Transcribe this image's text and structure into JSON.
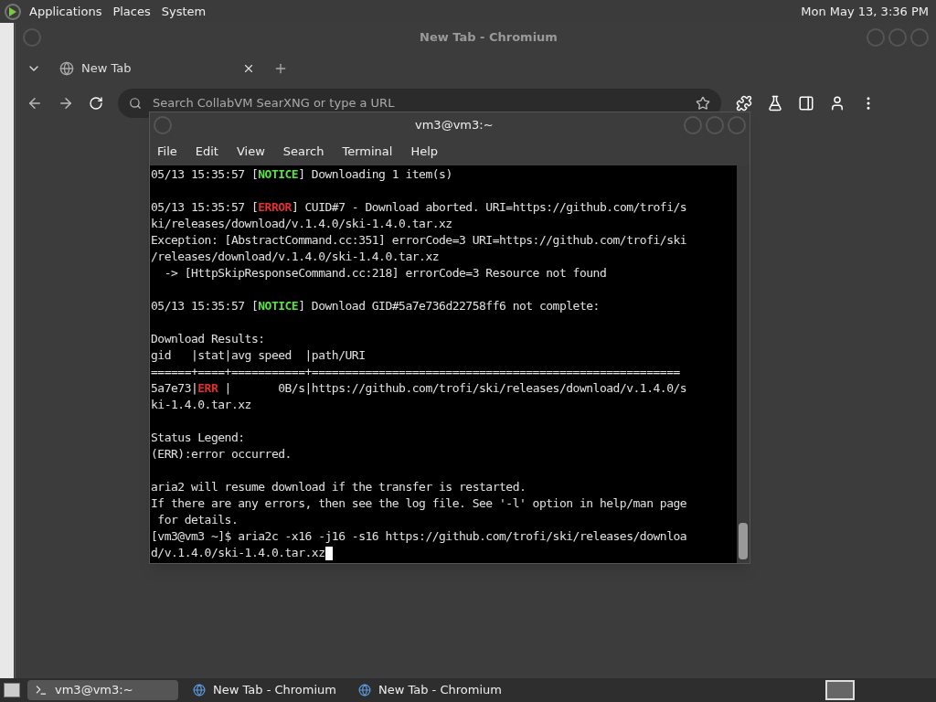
{
  "top_panel": {
    "menus": [
      "Applications",
      "Places",
      "System"
    ],
    "clock": "Mon May 13,  3:36 PM"
  },
  "browser": {
    "title": "New Tab - Chromium",
    "tabs": [
      {
        "label": "New Tab",
        "selected": true
      }
    ],
    "address_placeholder": "Search CollabVM SearXNG or type a URL"
  },
  "terminal": {
    "title": "vm3@vm3:~",
    "menus": [
      "File",
      "Edit",
      "View",
      "Search",
      "Terminal",
      "Help"
    ],
    "blocks": [
      [
        [
          {
            "text": "05/13 15:35:57 [",
            "kind": "plain"
          },
          {
            "text": "NOTICE",
            "kind": "notice"
          },
          {
            "text": "] Downloading 1 item(s)",
            "kind": "plain"
          }
        ]
      ],
      [
        [
          {
            "text": "05/13 15:35:57 [",
            "kind": "plain"
          },
          {
            "text": "ERROR",
            "kind": "error"
          },
          {
            "text": "] CUID#7 - Download aborted. URI=https://github.com/trofi/s",
            "kind": "plain"
          }
        ],
        [
          {
            "text": "ki/releases/download/v.1.4.0/ski-1.4.0.tar.xz",
            "kind": "plain"
          }
        ],
        [
          {
            "text": "Exception: [AbstractCommand.cc:351] errorCode=3 URI=https://github.com/trofi/ski",
            "kind": "plain"
          }
        ],
        [
          {
            "text": "/releases/download/v.1.4.0/ski-1.4.0.tar.xz",
            "kind": "plain"
          }
        ],
        [
          {
            "text": "  -> [HttpSkipResponseCommand.cc:218] errorCode=3 Resource not found",
            "kind": "plain"
          }
        ]
      ],
      [
        [
          {
            "text": "05/13 15:35:57 [",
            "kind": "plain"
          },
          {
            "text": "NOTICE",
            "kind": "notice"
          },
          {
            "text": "] Download GID#5a7e736d22758ff6 not complete:",
            "kind": "plain"
          }
        ]
      ],
      [
        [
          {
            "text": "Download Results:",
            "kind": "plain"
          }
        ],
        [
          {
            "text": "gid   |stat|avg speed  |path/URI",
            "kind": "plain"
          }
        ],
        [
          {
            "text": "======+====+===========+=======================================================",
            "kind": "plain"
          }
        ],
        [
          {
            "text": "5a7e73|",
            "kind": "plain"
          },
          {
            "text": "ERR",
            "kind": "error"
          },
          {
            "text": " |       0B/s|https://github.com/trofi/ski/releases/download/v.1.4.0/s",
            "kind": "plain"
          }
        ],
        [
          {
            "text": "ki-1.4.0.tar.xz",
            "kind": "plain"
          }
        ]
      ],
      [
        [
          {
            "text": "Status Legend:",
            "kind": "plain"
          }
        ],
        [
          {
            "text": "(ERR):error occurred.",
            "kind": "plain"
          }
        ]
      ],
      [
        [
          {
            "text": "aria2 will resume download if the transfer is restarted.",
            "kind": "plain"
          }
        ],
        [
          {
            "text": "If there are any errors, then see the log file. See '-l' option in help/man page",
            "kind": "plain"
          }
        ],
        [
          {
            "text": " for details.",
            "kind": "plain"
          }
        ],
        [
          {
            "text": "[vm3@vm3 ~]$ aria2c -x16 -j16 -s16 https://github.com/trofi/ski/releases/downloa",
            "kind": "plain"
          }
        ],
        [
          {
            "text": "d/v.1.4.0/ski-1.4.0.tar.xz",
            "kind": "plain"
          }
        ]
      ]
    ]
  },
  "taskbar": {
    "items": [
      {
        "label": "vm3@vm3:~",
        "kind": "terminal",
        "selected": true
      },
      {
        "label": "New Tab - Chromium",
        "kind": "browser",
        "selected": false
      },
      {
        "label": "New Tab - Chromium",
        "kind": "browser",
        "selected": false
      }
    ]
  }
}
